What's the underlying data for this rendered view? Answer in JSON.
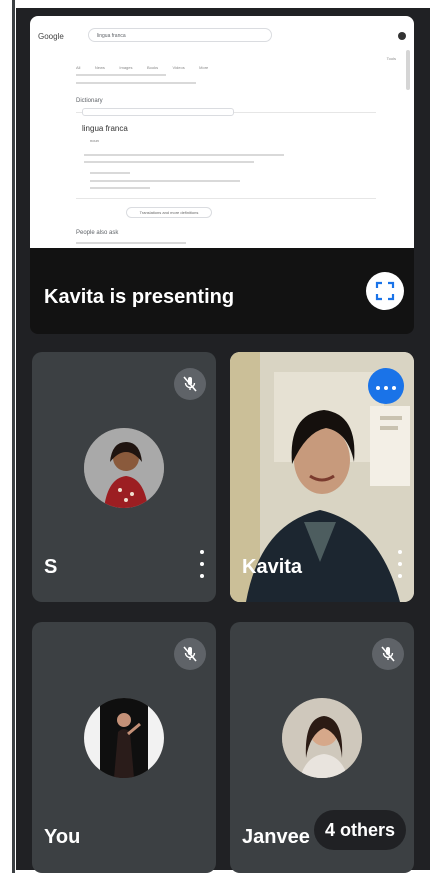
{
  "presentation": {
    "presenting_label": "Kavita is presenting",
    "shared_screen": {
      "brand": "Google",
      "search_text": "lingua franca",
      "tabs": [
        "All",
        "News",
        "Images",
        "Books",
        "Videos",
        "More",
        "Tools"
      ],
      "section_heading": "Dictionary",
      "result_title": "lingua franca",
      "result_subtitle": "noun",
      "button_label": "Translations and more definitions",
      "people_also_ask": "People also ask"
    }
  },
  "participants": [
    {
      "name": "S",
      "muted": true
    },
    {
      "name": "Kavita",
      "muted": false
    },
    {
      "name": "You",
      "muted": true
    },
    {
      "name": "Janvee",
      "muted": true
    }
  ],
  "others": {
    "label": "4 others"
  },
  "colors": {
    "background": "#202124",
    "tile": "#3c4043",
    "accent": "#1a73e8",
    "mute_bg": "#5f6368"
  },
  "icons": {
    "fullscreen": "fullscreen-icon",
    "mic_off": "mic-off-icon",
    "more": "more-horiz-icon",
    "kebab": "more-vert-icon"
  }
}
